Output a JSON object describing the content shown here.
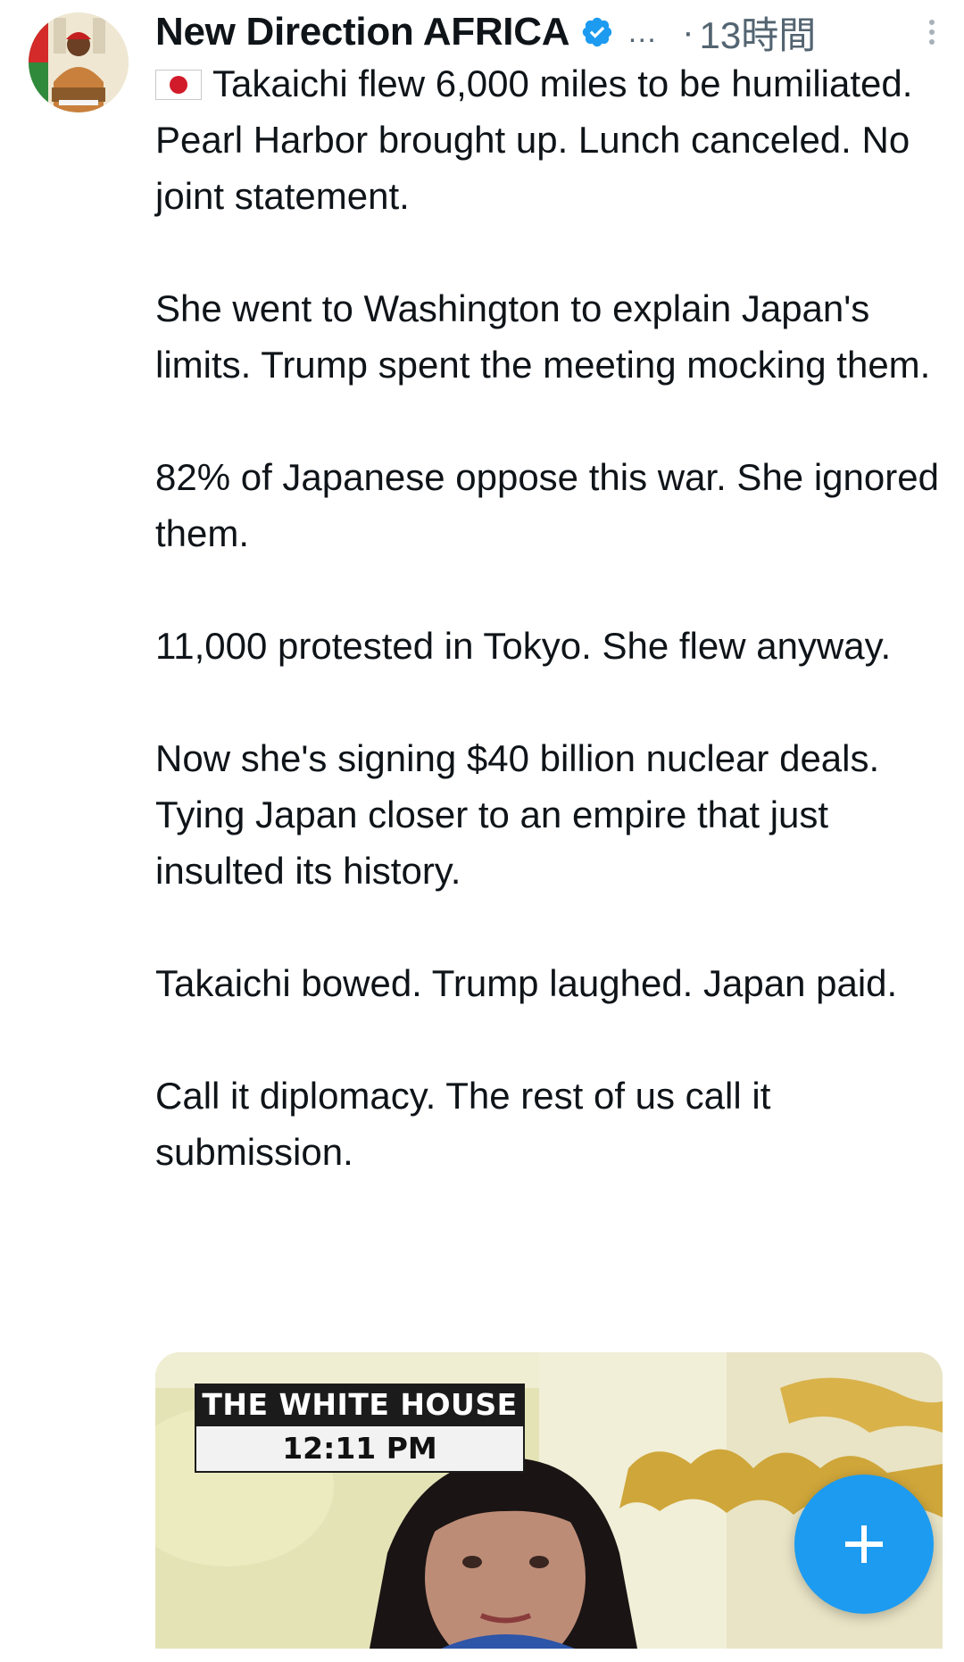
{
  "post": {
    "author": "New Direction AFRICA",
    "ellipsis": "…",
    "separator": "·",
    "time": "13時間",
    "text": "Takaichi flew 6,000 miles to be humiliated. Pearl Harbor brought up. Lunch canceled. No joint statement.\n\nShe went to Washington to explain Japan's limits. Trump spent the meeting mocking them.\n\n82% of Japanese oppose this war. She ignored them.\n\n11,000 protested in Tokyo. She flew anyway.\n\nNow she's signing $40 billion nuclear deals. Tying Japan closer to an empire that just insulted its history.\n\nTakaichi bowed. Trump laughed. Japan paid.\n\nCall it diplomacy. The rest of us call it submission."
  },
  "media": {
    "caption_line1": "THE WHITE HOUSE",
    "caption_line2": "12:11 PM"
  },
  "icons": {
    "verified": "verified-badge-icon",
    "more": "more-vertical-icon",
    "flag": "japan-flag-icon",
    "compose": "plus-icon"
  },
  "colors": {
    "accent": "#1d9bf0",
    "text": "#0f1419",
    "secondary": "#536471"
  }
}
